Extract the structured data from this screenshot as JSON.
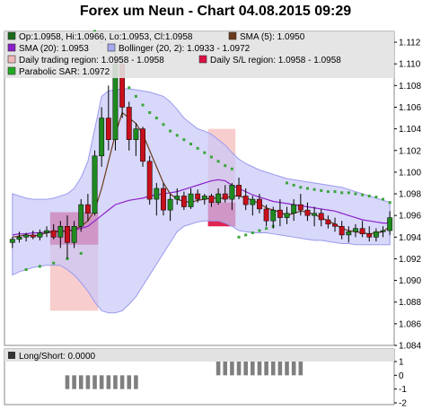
{
  "title": "Forex um Neun - Chart 04.08.2015 09:29",
  "legend": [
    {
      "id": "ohlc",
      "text": "Op:1.0958, Hi:1.0966, Lo:1.0953, Cl:1.0958",
      "color": "#1a6b1a"
    },
    {
      "id": "sma5",
      "text": "SMA (5): 1.0950",
      "color": "#6b3a1a"
    },
    {
      "id": "sma20",
      "text": "SMA (20): 1.0953",
      "color": "#8c1fc9"
    },
    {
      "id": "boll",
      "text": "Bollinger (20, 2): 1.0933 - 1.0972",
      "color": "#a8a8f0"
    },
    {
      "id": "dtr",
      "text": "Daily trading region: 1.0958 - 1.0958",
      "color": "#f2b8b8"
    },
    {
      "id": "dsl",
      "text": "Daily S/L region: 1.0958 - 1.0958",
      "color": "#dd1144"
    },
    {
      "id": "sar",
      "text": "Parabolic SAR: 1.0972",
      "color": "#22aa22"
    }
  ],
  "sub_legend": "Long/Short: 0.0000",
  "colors": {
    "up": "#1f8a1f",
    "down": "#c8101c",
    "bollinger_fill": "#c8c8f8",
    "bollinger_line": "#9a9aee",
    "sma20": "#8c1fc9",
    "sma5": "#6b3a1a",
    "sar": "#3aa53a",
    "trading_region": "#f7c4c4",
    "sl_region": "#dd1144",
    "grid_bg": "#ffffff",
    "legend_bg": "#dcdcdc",
    "bar": "#7f7f7f"
  },
  "chart_data": {
    "type": "candlestick",
    "ylim": [
      1.084,
      1.113
    ],
    "yticks": [
      "1.084",
      "1.086",
      "1.088",
      "1.090",
      "1.092",
      "1.094",
      "1.096",
      "1.098",
      "1.100",
      "1.102",
      "1.104",
      "1.106",
      "1.108",
      "1.110",
      "1.112"
    ],
    "candles": [
      [
        1.0935,
        1.094,
        1.093,
        1.0938
      ],
      [
        1.0938,
        1.0945,
        1.0935,
        1.094
      ],
      [
        1.094,
        1.0944,
        1.0936,
        1.0942
      ],
      [
        1.0942,
        1.0946,
        1.0938,
        1.094
      ],
      [
        1.094,
        1.0947,
        1.0937,
        1.0944
      ],
      [
        1.0944,
        1.095,
        1.094,
        1.0946
      ],
      [
        1.0946,
        1.0952,
        1.0938,
        1.094
      ],
      [
        1.094,
        1.0955,
        1.093,
        1.095
      ],
      [
        1.095,
        1.096,
        1.092,
        1.0935
      ],
      [
        1.0935,
        1.0955,
        1.093,
        1.095
      ],
      [
        1.095,
        1.0975,
        1.0945,
        1.097
      ],
      [
        1.097,
        1.098,
        1.0955,
        1.0962
      ],
      [
        1.0962,
        1.102,
        1.096,
        1.1015
      ],
      [
        1.1015,
        1.106,
        1.1005,
        1.105
      ],
      [
        1.105,
        1.108,
        1.102,
        1.103
      ],
      [
        1.103,
        1.111,
        1.102,
        1.11
      ],
      [
        1.11,
        1.1115,
        1.105,
        1.106
      ],
      [
        1.106,
        1.1065,
        1.102,
        1.103
      ],
      [
        1.103,
        1.1045,
        1.1015,
        1.104
      ],
      [
        1.104,
        1.1042,
        1.1005,
        1.101
      ],
      [
        1.101,
        1.1015,
        1.097,
        1.0975
      ],
      [
        1.0975,
        1.099,
        1.096,
        1.0985
      ],
      [
        1.0985,
        1.099,
        1.096,
        1.0965
      ],
      [
        1.0965,
        1.098,
        1.0955,
        1.0975
      ],
      [
        1.0975,
        1.0985,
        1.097,
        1.0978
      ],
      [
        1.0978,
        1.0982,
        1.0965,
        1.0968
      ],
      [
        1.0968,
        1.0985,
        1.0966,
        1.098
      ],
      [
        1.098,
        1.0984,
        1.0972,
        1.0975
      ],
      [
        1.0975,
        1.098,
        1.097,
        1.0978
      ],
      [
        1.0978,
        1.098,
        1.0968,
        1.0972
      ],
      [
        1.0972,
        1.0985,
        1.097,
        1.098
      ],
      [
        1.098,
        1.0988,
        1.0972,
        1.0975
      ],
      [
        1.0975,
        1.099,
        1.0965,
        1.0988
      ],
      [
        1.0988,
        1.0995,
        1.0975,
        1.0978
      ],
      [
        1.0978,
        1.0985,
        1.0965,
        1.097
      ],
      [
        1.097,
        1.0978,
        1.096,
        1.0975
      ],
      [
        1.0975,
        1.098,
        1.0962,
        1.0966
      ],
      [
        1.0966,
        1.097,
        1.095,
        1.0955
      ],
      [
        1.0955,
        1.0968,
        1.0948,
        1.0965
      ],
      [
        1.0965,
        1.0975,
        1.095,
        1.0958
      ],
      [
        1.0958,
        1.0968,
        1.0952,
        1.0962
      ],
      [
        1.0962,
        1.0975,
        1.0955,
        1.097
      ],
      [
        1.097,
        1.098,
        1.096,
        1.0965
      ],
      [
        1.0965,
        1.0972,
        1.0955,
        1.096
      ],
      [
        1.096,
        1.0968,
        1.095,
        1.0962
      ],
      [
        1.0962,
        1.0966,
        1.095,
        1.0956
      ],
      [
        1.0956,
        1.096,
        1.0948,
        1.0952
      ],
      [
        1.0952,
        1.0958,
        1.0945,
        1.095
      ],
      [
        1.095,
        1.0955,
        1.0938,
        1.0942
      ],
      [
        1.0942,
        1.095,
        1.0935,
        1.0945
      ],
      [
        1.0945,
        1.0952,
        1.094,
        1.0948
      ],
      [
        1.0948,
        1.0955,
        1.094,
        1.0943
      ],
      [
        1.0943,
        1.095,
        1.0936,
        1.094
      ],
      [
        1.094,
        1.0948,
        1.0936,
        1.0945
      ],
      [
        1.0945,
        1.095,
        1.094,
        1.0946
      ],
      [
        1.0946,
        1.0964,
        1.0942,
        1.0958
      ]
    ],
    "sma20": [
      1.0942,
      1.0943,
      1.0943,
      1.0944,
      1.0944,
      1.0945,
      1.0945,
      1.0946,
      1.0946,
      1.0947,
      1.0948,
      1.095,
      1.0955,
      1.096,
      1.0965,
      1.097,
      1.0972,
      1.0974,
      1.0975,
      1.0976,
      1.0978,
      1.0979,
      1.098,
      1.0981,
      1.0982,
      1.0984,
      1.0986,
      1.0988,
      1.099,
      1.0992,
      1.0993,
      1.0992,
      1.0988,
      1.0985,
      1.0982,
      1.0979,
      1.0977,
      1.0975,
      1.0973,
      1.0972,
      1.0971,
      1.097,
      1.0969,
      1.0968,
      1.0967,
      1.0966,
      1.0965,
      1.0964,
      1.0962,
      1.096,
      1.0958,
      1.0956,
      1.0955,
      1.0954,
      1.0953,
      1.0953
    ],
    "sma5": [
      1.094,
      1.0941,
      1.0942,
      1.0941,
      1.0942,
      1.0944,
      1.0945,
      1.0945,
      1.0945,
      1.0947,
      1.095,
      1.0955,
      1.0965,
      1.0985,
      1.101,
      1.1035,
      1.1055,
      1.105,
      1.1045,
      1.1035,
      1.102,
      1.1005,
      1.099,
      1.098,
      1.0975,
      1.0973,
      1.0972,
      1.0974,
      1.0975,
      1.0976,
      1.0976,
      1.0976,
      1.0978,
      1.0978,
      1.0976,
      1.0974,
      1.0971,
      1.0967,
      1.0965,
      1.0963,
      1.096,
      1.0962,
      1.0964,
      1.0963,
      1.0961,
      1.0958,
      1.0955,
      1.0952,
      1.0948,
      1.0946,
      1.0945,
      1.0944,
      1.0943,
      1.0944,
      1.0945,
      1.095
    ],
    "boll_upper": [
      1.098,
      1.0978,
      1.0976,
      1.0975,
      1.0975,
      1.0975,
      1.0976,
      1.0978,
      1.098,
      1.0985,
      1.0995,
      1.101,
      1.104,
      1.107,
      1.1075,
      1.1076,
      1.1077,
      1.1077,
      1.1076,
      1.1075,
      1.1074,
      1.1072,
      1.107,
      1.1065,
      1.1058,
      1.105,
      1.1045,
      1.104,
      1.1038,
      1.1035,
      1.103,
      1.1025,
      1.1018,
      1.1012,
      1.1008,
      1.1005,
      1.1002,
      1.1,
      1.0998,
      1.0996,
      1.0994,
      1.0993,
      1.0992,
      1.0991,
      1.099,
      1.0989,
      1.0988,
      1.0987,
      1.0986,
      1.0984,
      1.0982,
      1.098,
      1.0978,
      1.0976,
      1.0974,
      1.0972
    ],
    "boll_lower": [
      1.0905,
      1.0908,
      1.091,
      1.0912,
      1.0913,
      1.0914,
      1.0914,
      1.0914,
      1.091,
      1.0905,
      1.0898,
      1.089,
      1.088,
      1.0872,
      1.087,
      1.087,
      1.0872,
      1.0878,
      1.0885,
      1.0895,
      1.0905,
      1.0915,
      1.0925,
      1.0935,
      1.0945,
      1.095,
      1.0952,
      1.0954,
      1.0955,
      1.0955,
      1.0955,
      1.0953,
      1.095,
      1.0946,
      1.0945,
      1.0944,
      1.0944,
      1.0944,
      1.0943,
      1.0942,
      1.0941,
      1.094,
      1.0939,
      1.0938,
      1.0937,
      1.0937,
      1.0936,
      1.0935,
      1.0934,
      1.0934,
      1.0933,
      1.0933,
      1.0933,
      1.0933,
      1.0933,
      1.0933
    ],
    "sar": [
      [
        2,
        1.091
      ],
      [
        4,
        1.0913
      ],
      [
        6,
        1.0916
      ],
      [
        8,
        1.092
      ],
      [
        10,
        1.0925
      ],
      [
        12,
        1.113
      ],
      [
        13,
        1.112
      ],
      [
        14,
        1.1105
      ],
      [
        15,
        1.1095
      ],
      [
        16,
        1.1085
      ],
      [
        17,
        1.1078
      ],
      [
        18,
        1.107
      ],
      [
        19,
        1.1062
      ],
      [
        20,
        1.1055
      ],
      [
        21,
        1.105
      ],
      [
        22,
        1.1044
      ],
      [
        23,
        1.1038
      ],
      [
        24,
        1.1034
      ],
      [
        25,
        1.103
      ],
      [
        26,
        1.1026
      ],
      [
        27,
        1.1022
      ],
      [
        28,
        1.1018
      ],
      [
        29,
        1.1014
      ],
      [
        30,
        1.101
      ],
      [
        31,
        1.1006
      ],
      [
        32,
        1.1003
      ],
      [
        33,
        1.094
      ],
      [
        34,
        1.0942
      ],
      [
        35,
        1.0944
      ],
      [
        36,
        1.0946
      ],
      [
        37,
        1.0948
      ],
      [
        38,
        1.095
      ],
      [
        40,
        1.099
      ],
      [
        41,
        1.0988
      ],
      [
        42,
        1.0986
      ],
      [
        43,
        1.0985
      ],
      [
        44,
        1.0984
      ],
      [
        45,
        1.0983
      ],
      [
        46,
        1.0982
      ],
      [
        47,
        1.0982
      ],
      [
        48,
        1.0981
      ],
      [
        49,
        1.0981
      ],
      [
        50,
        1.098
      ],
      [
        51,
        1.0979
      ],
      [
        52,
        1.0978
      ],
      [
        53,
        1.0977
      ],
      [
        54,
        1.0975
      ],
      [
        55,
        1.0972
      ]
    ],
    "trading_regions": [
      [
        5.5,
        12.5,
        1.0872,
        1.0963
      ],
      [
        28.5,
        32.5,
        1.095,
        1.104
      ]
    ],
    "sl_regions": [
      [
        5.5,
        12.5,
        1.0933,
        1.0963
      ],
      [
        28.5,
        32.5,
        1.095,
        1.0972
      ]
    ],
    "long_short": {
      "ylim": [
        -2,
        1
      ],
      "yticks": [
        "1",
        "0",
        "-1",
        "-2"
      ],
      "short_bars": [
        8,
        18
      ],
      "long_bars": [
        30,
        42
      ]
    }
  }
}
